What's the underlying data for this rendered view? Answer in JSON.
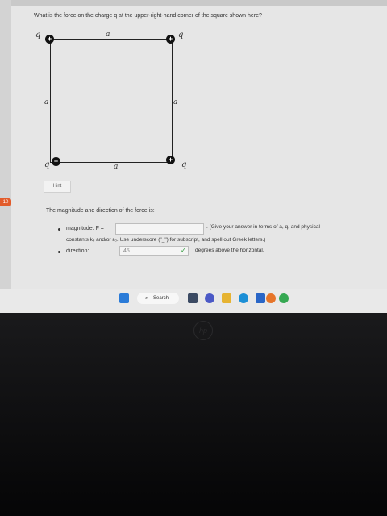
{
  "question": {
    "number": "10",
    "text": "What is the force on the charge q at the upper-right-hand corner of the square shown here?"
  },
  "diagram": {
    "side_label": "a",
    "charge_label": "q",
    "charge_sign": "+"
  },
  "hint": {
    "label": "Hint"
  },
  "answer": {
    "prompt": "The magnitude and direction of the force is:",
    "magnitude_label": "magnitude:  F =",
    "magnitude_note": ". (Give your answer in terms of a, q, and physical",
    "magnitude_note2": "constants kₑ and/or ε₀. Use underscore (\"_\") for subscript, and spell out Greek letters.)",
    "direction_label": "direction:",
    "direction_value": "45",
    "direction_units": "degrees above the horizontal."
  },
  "taskbar": {
    "search_label": "Search"
  },
  "colors": {
    "accent": "#e25b2a",
    "check": "#2e9a3a"
  }
}
